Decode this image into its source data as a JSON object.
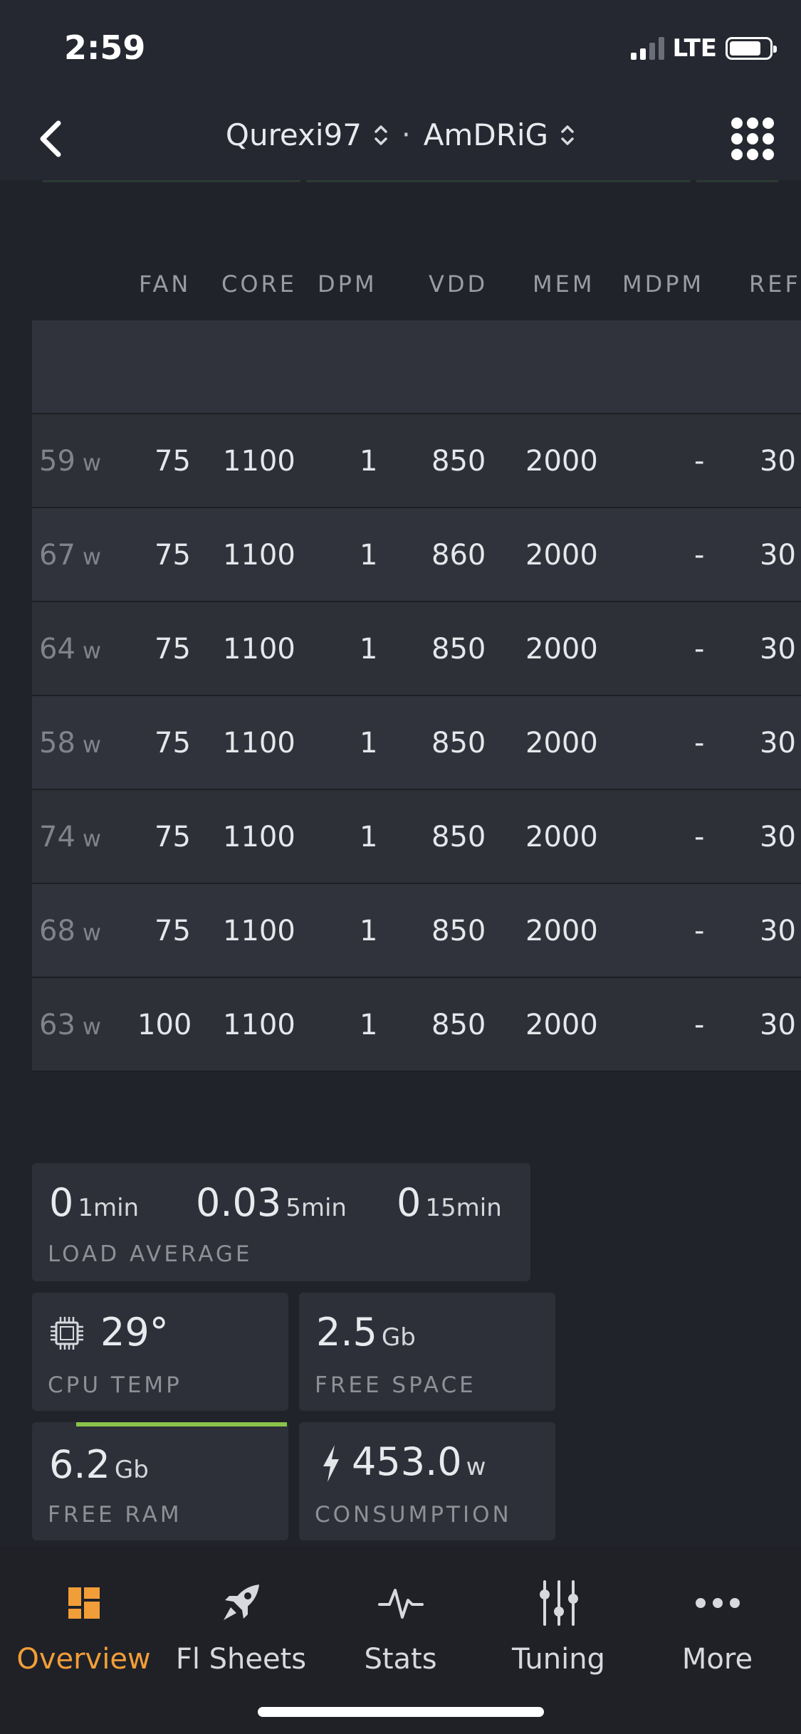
{
  "status": {
    "time": "2:59",
    "network": "LTE"
  },
  "nav": {
    "worker": "Qurexi97",
    "separator": "·",
    "rig": "AmDRiG"
  },
  "table": {
    "headers": [
      "FAN",
      "CORE",
      "DPM",
      "VDD",
      "MEM",
      "MDPM",
      "REF"
    ],
    "power_unit": "w",
    "rows": [
      {
        "power": "59",
        "fan": "75",
        "core": "1100",
        "dpm": "1",
        "vdd": "850",
        "mem": "2000",
        "mdpm": "-",
        "ref": "30"
      },
      {
        "power": "67",
        "fan": "75",
        "core": "1100",
        "dpm": "1",
        "vdd": "860",
        "mem": "2000",
        "mdpm": "-",
        "ref": "30"
      },
      {
        "power": "64",
        "fan": "75",
        "core": "1100",
        "dpm": "1",
        "vdd": "850",
        "mem": "2000",
        "mdpm": "-",
        "ref": "30"
      },
      {
        "power": "58",
        "fan": "75",
        "core": "1100",
        "dpm": "1",
        "vdd": "850",
        "mem": "2000",
        "mdpm": "-",
        "ref": "30"
      },
      {
        "power": "74",
        "fan": "75",
        "core": "1100",
        "dpm": "1",
        "vdd": "850",
        "mem": "2000",
        "mdpm": "-",
        "ref": "30"
      },
      {
        "power": "68",
        "fan": "75",
        "core": "1100",
        "dpm": "1",
        "vdd": "850",
        "mem": "2000",
        "mdpm": "-",
        "ref": "30"
      },
      {
        "power": "63",
        "fan": "100",
        "core": "1100",
        "dpm": "1",
        "vdd": "850",
        "mem": "2000",
        "mdpm": "-",
        "ref": "30"
      }
    ]
  },
  "load": {
    "v1": "0",
    "u1": "1min",
    "v5": "0.03",
    "u5": "5min",
    "v15": "0",
    "u15": "15min",
    "label": "LOAD AVERAGE"
  },
  "cpu": {
    "value": "29°",
    "label": "CPU TEMP"
  },
  "space": {
    "value": "2.5",
    "unit": "Gb",
    "label": "FREE SPACE"
  },
  "ram": {
    "value": "6.2",
    "unit": "Gb",
    "label": "FREE RAM"
  },
  "power": {
    "value": "453.0",
    "unit": "w",
    "label": "CONSUMPTION"
  },
  "tabs": [
    {
      "label": "Overview",
      "icon": "overview-icon"
    },
    {
      "label": "Fl Sheets",
      "icon": "rocket-icon"
    },
    {
      "label": "Stats",
      "icon": "pulse-icon"
    },
    {
      "label": "Tuning",
      "icon": "sliders-icon"
    },
    {
      "label": "More",
      "icon": "more-icon"
    }
  ],
  "colors": {
    "accent": "#f29e38",
    "ram_bar": "#8bc34a",
    "background": "#21232b"
  }
}
